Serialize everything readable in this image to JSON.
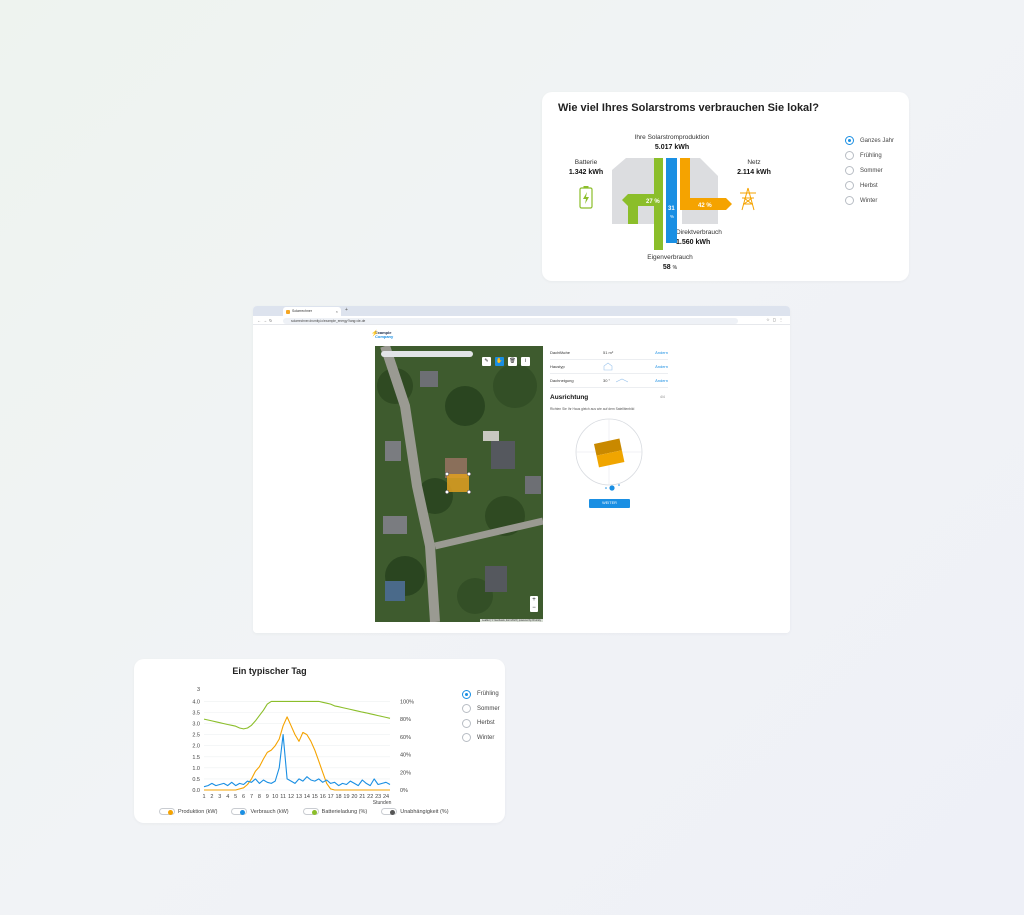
{
  "flow": {
    "title": "Wie viel Ihres Solarstroms verbrauchen Sie lokal?",
    "production_label": "Ihre Solarstromproduktion",
    "production_value": "5.017 kWh",
    "battery_label": "Batterie",
    "battery_value": "1.342 kWh",
    "grid_label": "Netz",
    "grid_value": "2.114 kWh",
    "direct_label": "Direktverbrauch",
    "direct_value": "1.560 kWh",
    "self_label": "Eigenverbrauch",
    "self_value": "58",
    "self_unit": "%",
    "pct_battery": "27 %",
    "pct_direct": "31",
    "pct_direct_unit": "%",
    "pct_grid": "42 %",
    "seasons": [
      {
        "label": "Ganzes Jahr",
        "selected": true
      },
      {
        "label": "Frühling",
        "selected": false
      },
      {
        "label": "Sommer",
        "selected": false
      },
      {
        "label": "Herbst",
        "selected": false
      },
      {
        "label": "Winter",
        "selected": false
      }
    ],
    "colors": {
      "green": "#8bbe2a",
      "blue": "#1a8fe3",
      "orange": "#f5a300",
      "house": "#dcdde0"
    }
  },
  "browser": {
    "tab_title": "Solarrechner",
    "url": "solarrechner.drumity.io/example_energy?lang=de-de",
    "logo_line1": "Example",
    "logo_line2": "Company",
    "rows": [
      {
        "key": "Dachfläche",
        "value": "51 m²",
        "edit": "Ändern"
      },
      {
        "key": "Haustyp",
        "value": "",
        "edit": "Ändern"
      },
      {
        "key": "Dachneigung",
        "value": "30 °",
        "edit": "Ändern"
      }
    ],
    "section_title": "Ausrichtung",
    "step": "4/4",
    "hint": "Richten Sie Ihr Haus gleich aus wie auf dem Satellitenbild",
    "next_button": "WEITER",
    "map_attribution": "Leaflet | © Geobasis, Esri 2023 | powered by Drumity"
  },
  "day": {
    "title": "Ein typischer Tag",
    "seasons": [
      {
        "label": "Frühling",
        "selected": true
      },
      {
        "label": "Sommer",
        "selected": false
      },
      {
        "label": "Herbst",
        "selected": false
      },
      {
        "label": "Winter",
        "selected": false
      }
    ],
    "legend": [
      {
        "label": "Produktion (kW)",
        "color": "#f5a300"
      },
      {
        "label": "Verbrauch (kW)",
        "color": "#1a8fe3"
      },
      {
        "label": "Batterieladung (%)",
        "color": "#8bbe2a"
      },
      {
        "label": "Unabhängigkeit (%)",
        "color": "#555555"
      }
    ]
  },
  "chart_data": {
    "type": "line",
    "title": "Ein typischer Tag",
    "xlabel": "Stunden",
    "ylabel_left": "",
    "ylabel_right": "",
    "x": [
      1,
      1.5,
      2,
      2.5,
      3,
      3.5,
      4,
      4.5,
      5,
      5.5,
      6,
      6.5,
      7,
      7.5,
      8,
      8.5,
      9,
      9.5,
      10,
      10.5,
      11,
      11.5,
      12,
      12.5,
      13,
      13.5,
      14,
      14.5,
      15,
      15.5,
      16,
      16.5,
      17,
      17.5,
      18,
      18.5,
      19,
      19.5,
      20,
      20.5,
      21,
      21.5,
      22,
      22.5,
      23,
      23.5,
      24,
      24.5
    ],
    "x_ticks": [
      1,
      2,
      3,
      4,
      5,
      6,
      7,
      8,
      9,
      10,
      11,
      12,
      13,
      14,
      15,
      16,
      17,
      18,
      19,
      20,
      21,
      22,
      23,
      24
    ],
    "y_left_ticks": [
      0.0,
      0.5,
      1.0,
      1.5,
      2.0,
      2.5,
      3.0,
      3.5,
      4.0
    ],
    "y_left_tick_labels": [
      "0.0",
      "0.5",
      "1.0",
      "1.5",
      "2.0",
      "2.5",
      "3.0",
      "3.5",
      "4.0"
    ],
    "y_left_top_label": "3",
    "y_right_ticks": [
      0,
      20,
      40,
      60,
      80,
      100
    ],
    "y_right_tick_labels": [
      "0%",
      "20%",
      "40%",
      "60%",
      "80%",
      "100%"
    ],
    "ylim_left": [
      0,
      4.2
    ],
    "ylim_right": [
      0,
      105
    ],
    "series": [
      {
        "name": "Produktion (kW)",
        "axis": "left",
        "color": "#f5a300",
        "values": [
          0,
          0,
          0,
          0,
          0,
          0,
          0,
          0,
          0,
          0.05,
          0.1,
          0.25,
          0.5,
          0.85,
          1.05,
          1.4,
          1.7,
          1.8,
          2.0,
          2.3,
          2.9,
          3.3,
          2.9,
          2.5,
          2.2,
          2.6,
          2.5,
          2.2,
          1.8,
          1.3,
          0.8,
          0.3,
          0.05,
          0,
          0,
          0,
          0,
          0,
          0,
          0,
          0,
          0,
          0,
          0,
          0,
          0,
          0,
          0
        ]
      },
      {
        "name": "Verbrauch (kW)",
        "axis": "left",
        "color": "#1a8fe3",
        "values": [
          0.15,
          0.2,
          0.3,
          0.2,
          0.25,
          0.3,
          0.2,
          0.35,
          0.2,
          0.3,
          0.25,
          0.4,
          0.35,
          0.5,
          0.3,
          0.45,
          0.35,
          0.3,
          0.4,
          1.0,
          2.5,
          0.5,
          0.4,
          0.3,
          0.5,
          0.4,
          0.6,
          0.45,
          0.4,
          0.5,
          0.35,
          0.45,
          0.3,
          0.35,
          0.2,
          0.3,
          0.25,
          0.4,
          0.3,
          0.2,
          0.45,
          0.3,
          0.2,
          0.5,
          0.25,
          0.3,
          0.35,
          0.25
        ]
      },
      {
        "name": "Batterieladung (%)",
        "axis": "right",
        "color": "#8bbe2a",
        "values": [
          80,
          79,
          78,
          77,
          76,
          75,
          74,
          73,
          72,
          70,
          69,
          70,
          73,
          78,
          84,
          90,
          97,
          100,
          100,
          100,
          100,
          100,
          100,
          100,
          100,
          100,
          100,
          100,
          100,
          100,
          99,
          98,
          97,
          95,
          94,
          93,
          92,
          91,
          90,
          89,
          88,
          87,
          86,
          85,
          84,
          83,
          82,
          81
        ]
      }
    ]
  }
}
